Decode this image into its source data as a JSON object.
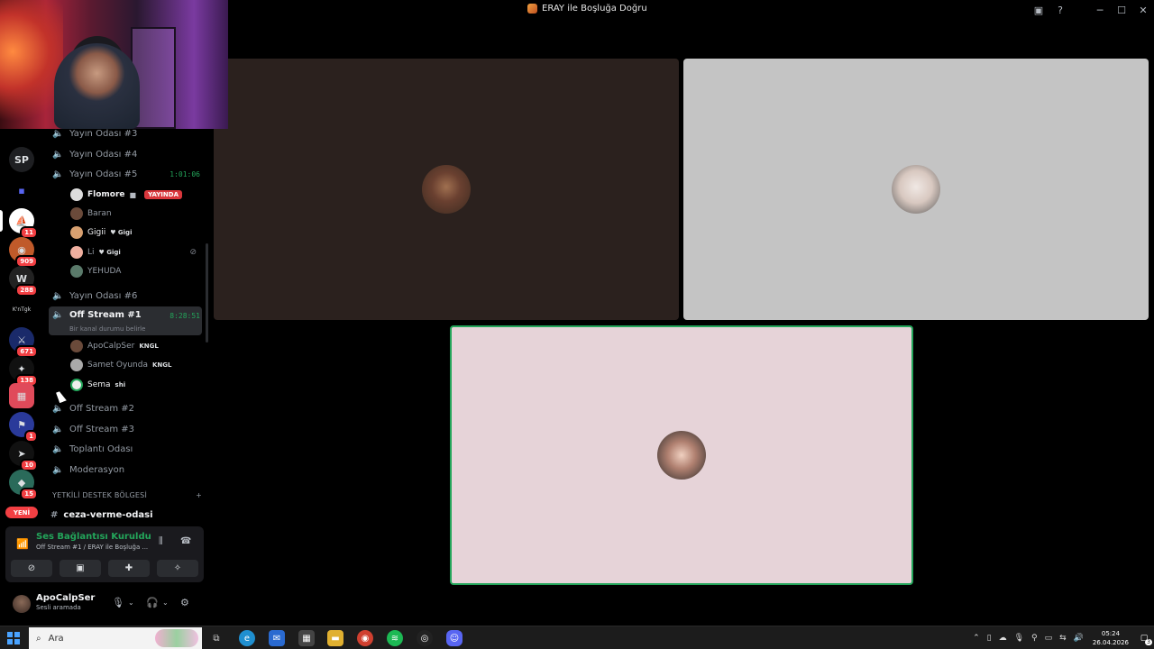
{
  "window": {
    "title": "ERAY ile Boşluğa Doğru",
    "icons": [
      "screen-share-icon",
      "help-icon"
    ],
    "controls": [
      "─",
      "☐",
      "✕"
    ]
  },
  "rail": {
    "items": [
      {
        "name": "server-sp",
        "label": "SP",
        "badge": ""
      },
      {
        "name": "server-folder",
        "label": "▪",
        "badge": ""
      },
      {
        "name": "server-a",
        "label": "⛵",
        "badge": "11"
      },
      {
        "name": "server-b",
        "label": "◉",
        "badge": "909"
      },
      {
        "name": "server-w",
        "label": "W",
        "badge": "288"
      },
      {
        "name": "server-kotilk",
        "label": "K'nTgk",
        "badge": ""
      },
      {
        "name": "server-c",
        "label": "⚔",
        "badge": "671"
      },
      {
        "name": "server-d",
        "label": "✦",
        "badge": "138"
      },
      {
        "name": "server-e",
        "label": "▦",
        "badge": ""
      },
      {
        "name": "server-f",
        "label": "⚑",
        "badge": "1"
      },
      {
        "name": "server-g",
        "label": "➤",
        "badge": "10"
      },
      {
        "name": "server-h",
        "label": "◆",
        "badge": "15"
      }
    ],
    "new_label": "YENİ"
  },
  "channels": {
    "voice1": "Yayın Odası #3",
    "voice2": "Yayın Odası #4",
    "voice3": "Yayın Odası #5",
    "voice3_timer": "1:01:06",
    "voice3_users": [
      {
        "name": "Flomore",
        "tag": "",
        "live": "YAYINDA"
      },
      {
        "name": "Baran",
        "tag": "",
        "live": ""
      },
      {
        "name": "Gigii",
        "tag": "♥ Gigi",
        "live": ""
      },
      {
        "name": "Li",
        "tag": "♥ Gigi",
        "live": ""
      },
      {
        "name": "YEHUDA",
        "tag": "",
        "live": ""
      }
    ],
    "voice4": "Yayın Odası #6",
    "active": "Off Stream #1",
    "active_timer": "8:28:51",
    "active_sub": "Bir kanal durumu belirle",
    "active_users": [
      {
        "name": "ApoCalpSer",
        "tag": "KNGL"
      },
      {
        "name": "Samet Oyunda",
        "tag": "KNGL"
      },
      {
        "name": "Sema",
        "tag": "shi"
      }
    ],
    "voice5": "Off Stream #2",
    "voice6": "Off Stream #3",
    "voice7": "Toplantı Odası",
    "voice8": "Moderasyon",
    "category": "YETKİLİ DESTEK BÖLGESİ",
    "text_channel": "ceza-verme-odasi"
  },
  "voice_panel": {
    "title": "Ses Bağlantısı Kuruldu",
    "sub": "Off Stream #1 / ERAY ile Boşluğa ..."
  },
  "user_panel": {
    "name": "ApoCalpSer",
    "status": "Sesli aramada"
  },
  "taskbar": {
    "search_placeholder": "Ara",
    "time": "05:24",
    "date": "26.04.2026",
    "notifications": "3"
  }
}
